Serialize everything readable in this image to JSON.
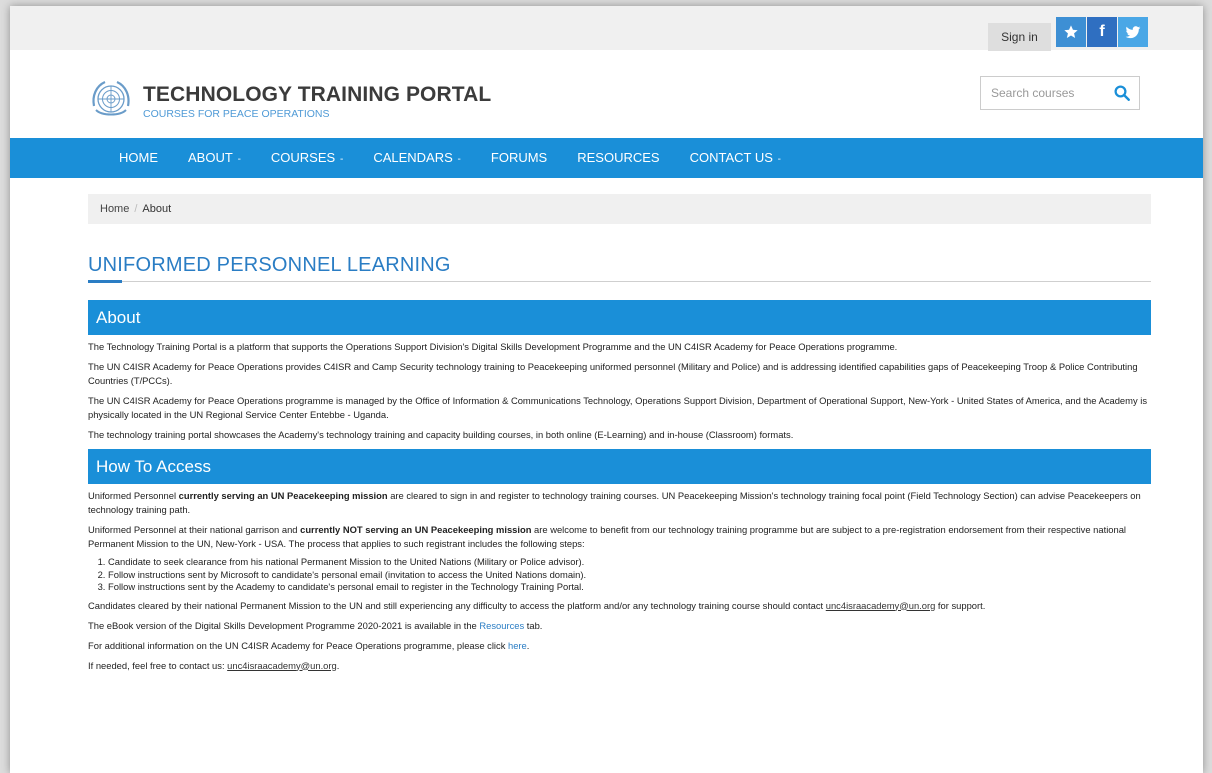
{
  "topbar": {
    "signin_label": "Sign in",
    "social": [
      {
        "icon": "star-icon"
      },
      {
        "icon": "facebook-icon",
        "glyph": "f"
      },
      {
        "icon": "twitter-icon"
      }
    ]
  },
  "header": {
    "title": "TECHNOLOGY TRAINING PORTAL",
    "subtitle": "COURSES FOR PEACE OPERATIONS",
    "search_placeholder": "Search courses",
    "search_icon": "search-icon"
  },
  "nav": {
    "items": [
      {
        "label": "HOME",
        "caret": ""
      },
      {
        "label": "ABOUT",
        "caret": " -"
      },
      {
        "label": "COURSES",
        "caret": " -"
      },
      {
        "label": "CALENDARS",
        "caret": " -"
      },
      {
        "label": "FORUMS",
        "caret": ""
      },
      {
        "label": "RESOURCES",
        "caret": ""
      },
      {
        "label": "CONTACT US",
        "caret": " -"
      }
    ]
  },
  "breadcrumb": {
    "home": "Home",
    "separator": "/",
    "current": "About"
  },
  "main": {
    "page_title": "UNIFORMED PERSONNEL LEARNING",
    "about": {
      "heading": "About",
      "paragraphs": [
        "The Technology Training Portal is a platform that supports the Operations Support Division's Digital Skills Development Programme and the UN C4ISR Academy for Peace Operations programme.",
        "The UN C4ISR Academy for Peace Operations provides C4ISR and Camp Security technology training to Peacekeeping uniformed personnel (Military and Police) and is addressing identified capabilities gaps of Peacekeeping Troop & Police Contributing Countries (T/PCCs).",
        "The UN C4ISR Academy for Peace Operations programme is managed by the Office of Information & Communications Technology, Operations Support Division, Department of Operational Support, New-York - United States of America, and the Academy is physically located in the UN Regional Service Center Entebbe - Uganda.",
        "The technology training portal showcases the Academy's technology training and capacity building courses, in both online (E-Learning) and in-house (Classroom) formats."
      ]
    },
    "access": {
      "heading": "How To Access",
      "p1_start": "Uniformed Personnel ",
      "p1_bold": "currently serving an UN Peacekeeping mission",
      "p1_end": " are cleared to sign in and register to technology training courses. UN Peacekeeping Mission's technology training focal point (Field Technology Section) can advise Peacekeepers on technology training path.",
      "p2_start": "Uniformed Personnel at their national garrison and ",
      "p2_bold": "currently NOT serving an UN Peacekeeping mission",
      "p2_end": " are welcome to benefit from our technology training programme but are subject to a pre-registration endorsement from their respective national Permanent Mission to the UN, New-York - USA. The process that applies to such registrant includes the following steps:",
      "steps": [
        "Candidate to seek clearance from his national Permanent Mission to the United Nations (Military or Police advisor).",
        "Follow instructions sent by Microsoft to candidate's personal email (invitation to access the United Nations domain).",
        "Follow instructions sent by the Academy to candidate's personal email to register in the Technology Training Portal."
      ],
      "p3_start": "Candidates cleared by their national Permanent Mission to the UN and still experiencing any difficulty to access the platform and/or any technology training course should contact ",
      "p3_email": "unc4israacademy@un.org",
      "p3_end": " for support.",
      "p4_start": "The eBook version of the Digital Skills Development Programme 2020-2021 is available in the ",
      "p4_link": "Resources",
      "p4_end": " tab.",
      "p5_start": "For additional information on the UN C4ISR Academy for Peace Operations programme, please click ",
      "p5_link": "here",
      "p5_end": ".",
      "p6_start": "If needed, feel free to contact us: ",
      "p6_email": "unc4israacademy@un.org",
      "p6_end": "."
    }
  },
  "colors": {
    "primary": "#1a8fd8",
    "title_blue": "#2a7dc4",
    "topbar_bg": "#f0f0f0"
  }
}
